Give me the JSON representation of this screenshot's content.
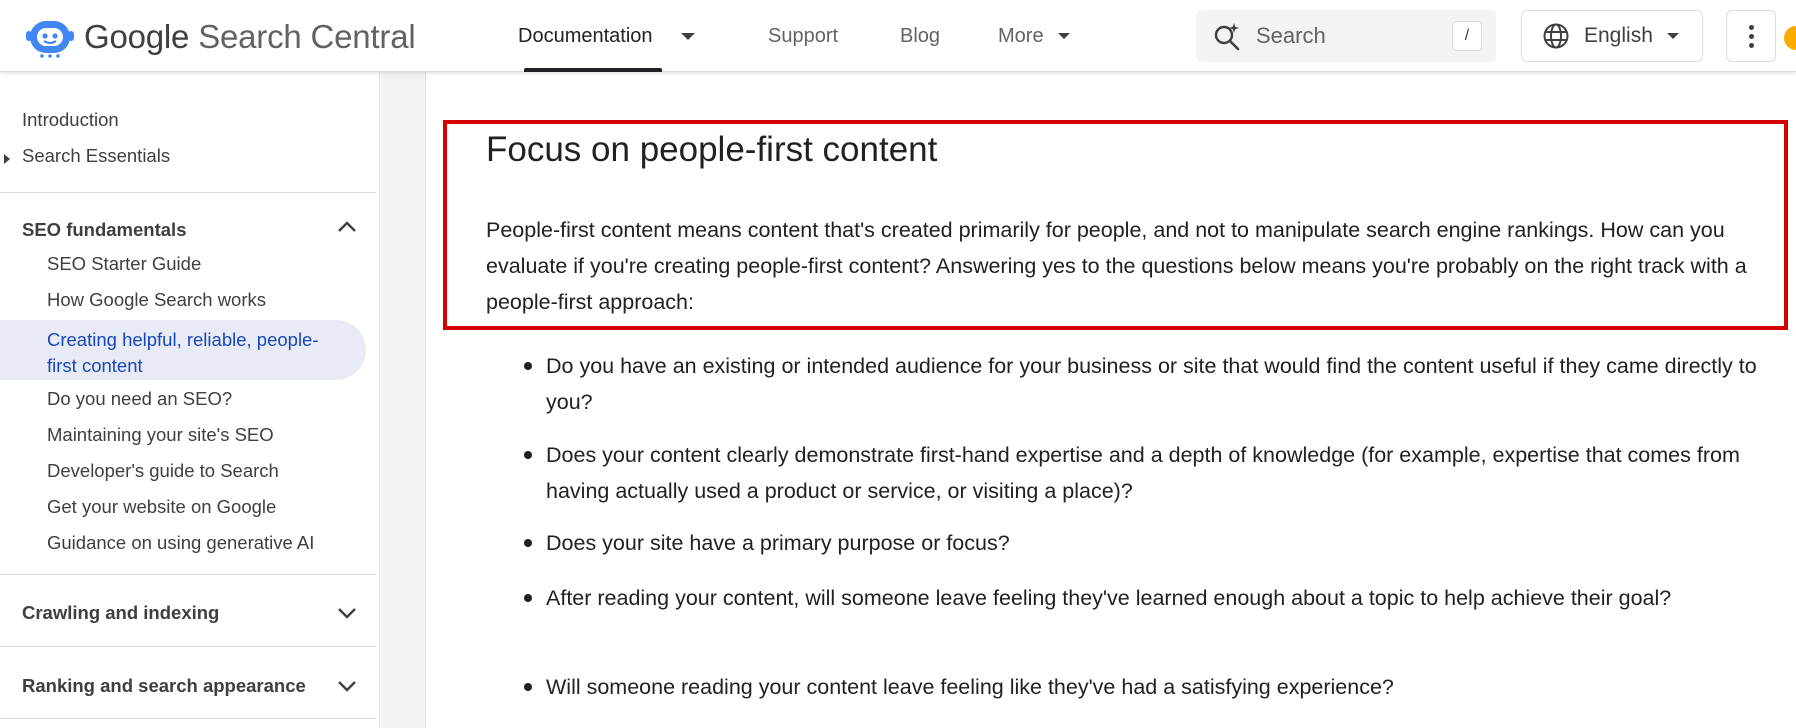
{
  "header": {
    "logo_brand": "Google",
    "logo_product": "Search Central",
    "nav": [
      {
        "label": "Documentation"
      },
      {
        "label": "Support"
      },
      {
        "label": "Blog"
      },
      {
        "label": "More"
      }
    ],
    "search": {
      "placeholder": "Search",
      "shortcut": "/"
    },
    "language": "English"
  },
  "sidebar": {
    "top_links": [
      "Introduction",
      "Search Essentials"
    ],
    "seo_fundamentals": {
      "title": "SEO fundamentals",
      "items": [
        "SEO Starter Guide",
        "How Google Search works",
        "Creating helpful, reliable, people-first content",
        "Do you need an SEO?",
        "Maintaining your site's SEO",
        "Developer's guide to Search",
        "Get your website on Google",
        "Guidance on using generative AI"
      ],
      "active_index": 2
    },
    "sections": [
      "Crawling and indexing",
      "Ranking and search appearance"
    ]
  },
  "content": {
    "heading": "Focus on people-first content",
    "intro": "People-first content means content that's created primarily for people, and not to manipulate search engine rankings. How can you evaluate if you're creating people-first content? Answering yes to the questions below means you're probably on the right track with a people-first approach:",
    "bullets": [
      "Do you have an existing or intended audience for your business or site that would find the content useful if they came directly to you?",
      "Does your content clearly demonstrate first-hand expertise and a depth of knowledge (for example, expertise that comes from having actually used a product or service, or visiting a place)?",
      "Does your site have a primary purpose or focus?",
      "After reading your content, will someone leave feeling they've learned enough about a topic to help achieve their goal?",
      "Will someone reading your content leave feeling like they've had a satisfying experience?"
    ]
  },
  "colors": {
    "highlight_border": "#d50000",
    "active_nav_bg": "#e8eaf6",
    "active_nav_text": "#1a47b8"
  }
}
